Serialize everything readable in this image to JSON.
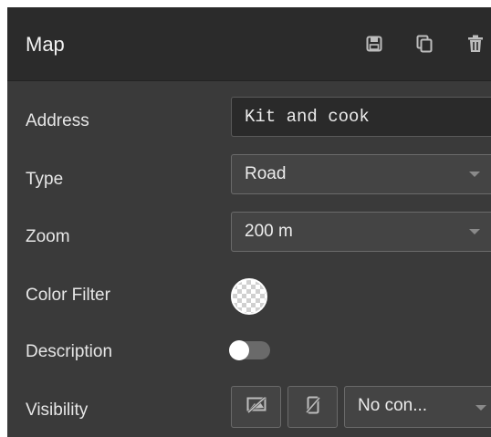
{
  "header": {
    "title": "Map",
    "icons": [
      "save-icon",
      "duplicate-icon",
      "delete-icon"
    ]
  },
  "rows": {
    "address": {
      "label": "Address",
      "value": "Kit and cook"
    },
    "type": {
      "label": "Type",
      "value": "Road"
    },
    "zoom": {
      "label": "Zoom",
      "value": "200 m"
    },
    "color_filter": {
      "label": "Color Filter",
      "value_icon": "transparent-swatch"
    },
    "description": {
      "label": "Description",
      "toggle_on": false
    },
    "visibility": {
      "label": "Visibility",
      "select_value": "No con...",
      "icons": [
        "hide-on-desktop-icon",
        "hide-on-mobile-icon"
      ]
    }
  },
  "colors": {
    "panel_bg": "#3a3a3a",
    "header_bg": "#2b2b2b",
    "field_bg": "#444444",
    "text": "#e6e6e6"
  }
}
